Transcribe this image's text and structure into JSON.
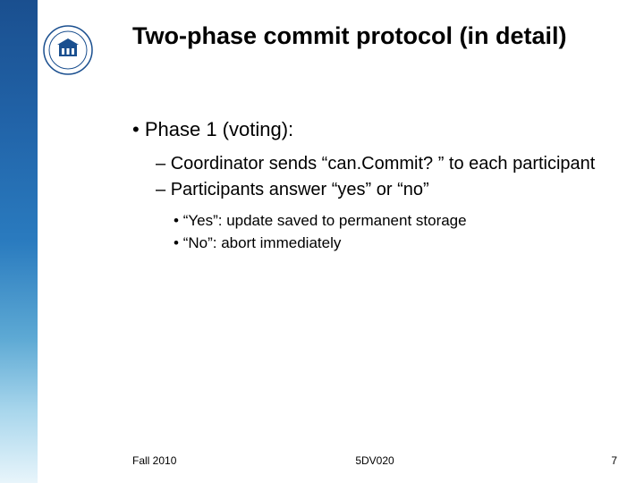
{
  "title": "Two-phase commit protocol (in detail)",
  "bullets": {
    "phase": "Phase 1 (voting):",
    "sub1": "Coordinator sends “can.Commit? ” to each participant",
    "sub2": "Participants answer “yes” or “no”",
    "subsub1": "“Yes”: update saved to permanent storage",
    "subsub2": "“No”: abort immediately"
  },
  "footer": {
    "left": "Fall 2010",
    "center": "5DV020",
    "right": "7"
  }
}
